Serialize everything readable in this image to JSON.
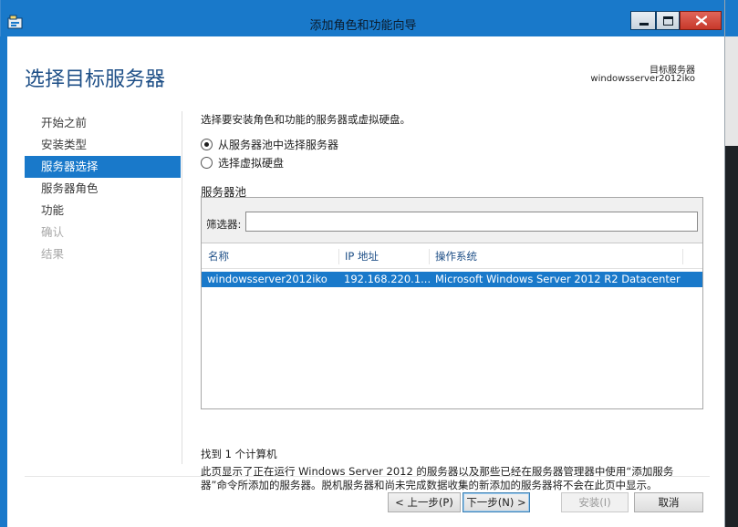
{
  "window": {
    "title": "添加角色和功能向导"
  },
  "header": {
    "page_title": "选择目标服务器",
    "target_label": "目标服务器",
    "target_value": "windowsserver2012iko"
  },
  "nav": {
    "items": [
      {
        "label": "开始之前",
        "state": "normal"
      },
      {
        "label": "安装类型",
        "state": "normal"
      },
      {
        "label": "服务器选择",
        "state": "active"
      },
      {
        "label": "服务器角色",
        "state": "normal"
      },
      {
        "label": "功能",
        "state": "normal"
      },
      {
        "label": "确认",
        "state": "disabled"
      },
      {
        "label": "结果",
        "state": "disabled"
      }
    ]
  },
  "content": {
    "intro": "选择要安装角色和功能的服务器或虚拟硬盘。",
    "radio_pool": "从服务器池中选择服务器",
    "radio_vhd": "选择虚拟硬盘",
    "pool_label": "服务器池",
    "filter_label": "筛选器:",
    "filter_value": "",
    "columns": [
      "名称",
      "IP 地址",
      "操作系统"
    ],
    "rows": [
      {
        "name": "windowsserver2012iko",
        "ip": "192.168.220.1...",
        "os": "Microsoft Windows Server 2012 R2 Datacenter"
      }
    ],
    "found": "找到 1 个计算机",
    "description": "此页显示了正在运行 Windows Server 2012 的服务器以及那些已经在服务器管理器中使用“添加服务器”命令所添加的服务器。脱机服务器和尚未完成数据收集的新添加的服务器将不会在此页中显示。"
  },
  "footer": {
    "prev": "< 上一步(P)",
    "next": "下一步(N) >",
    "install": "安装(I)",
    "cancel": "取消"
  },
  "colors": {
    "accent": "#1979ca",
    "title_text": "#1e4f87",
    "close_button": "#c7382a"
  },
  "icons": [
    "wizard-app-icon",
    "minimize-icon",
    "maximize-icon",
    "close-icon"
  ]
}
